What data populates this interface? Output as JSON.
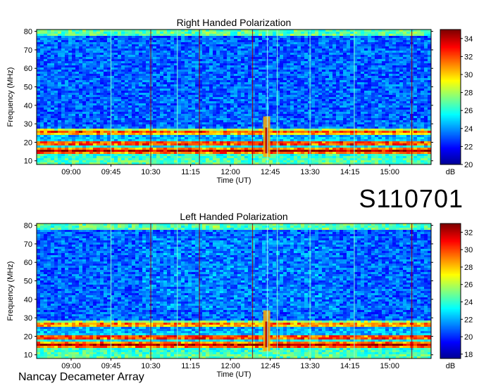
{
  "observation_id": "S110701",
  "footer_label": "Nancay Decameter Array",
  "chart_data": [
    {
      "type": "heatmap",
      "title": "Right Handed Polarization",
      "xlabel": "Time (UT)",
      "ylabel": "Frequency (MHz)",
      "x_ticks": [
        "09:00",
        "09:45",
        "10:30",
        "11:15",
        "12:00",
        "12:45",
        "13:30",
        "14:15",
        "15:00"
      ],
      "y_ticks": [
        10,
        20,
        30,
        40,
        50,
        60,
        70,
        80
      ],
      "ylim": [
        8,
        81
      ],
      "colorbar": {
        "label": "dB",
        "ticks": [
          20,
          22,
          24,
          26,
          28,
          30,
          32,
          34
        ],
        "range": [
          20,
          35
        ]
      },
      "colormap": [
        "#00008f",
        "#0000ff",
        "#0080ff",
        "#00ffff",
        "#80ff80",
        "#ffff00",
        "#ff8000",
        "#ff0000",
        "#800000"
      ],
      "features": {
        "burst_time": "12:45",
        "vertical_lines_light": [
          "09:45",
          "11:00",
          "12:53",
          "13:30",
          "14:20"
        ],
        "vertical_lines_red": [
          "10:30",
          "11:25",
          "12:25",
          "15:25"
        ],
        "strong_bands_mhz": [
          16,
          20,
          26
        ]
      }
    },
    {
      "type": "heatmap",
      "title": "Left Handed Polarization",
      "xlabel": "Time (UT)",
      "ylabel": "Frequency (MHz)",
      "x_ticks": [
        "09:00",
        "09:45",
        "10:30",
        "11:15",
        "12:00",
        "12:45",
        "13:30",
        "14:15",
        "15:00"
      ],
      "y_ticks": [
        10,
        20,
        30,
        40,
        50,
        60,
        70,
        80
      ],
      "ylim": [
        8,
        81
      ],
      "colorbar": {
        "label": "dB",
        "ticks": [
          18,
          20,
          22,
          24,
          26,
          28,
          30,
          32
        ],
        "range": [
          17.5,
          33
        ]
      },
      "colormap": [
        "#00008f",
        "#0000ff",
        "#0080ff",
        "#00ffff",
        "#80ff80",
        "#ffff00",
        "#ff8000",
        "#ff0000",
        "#800000"
      ],
      "features": {
        "burst_time": "12:45",
        "vertical_lines_light": [
          "09:45",
          "11:00",
          "12:53",
          "13:30",
          "14:20"
        ],
        "vertical_lines_red": [
          "10:30",
          "11:25",
          "12:25",
          "15:25"
        ],
        "strong_bands_mhz": [
          16,
          20,
          27
        ]
      }
    }
  ]
}
